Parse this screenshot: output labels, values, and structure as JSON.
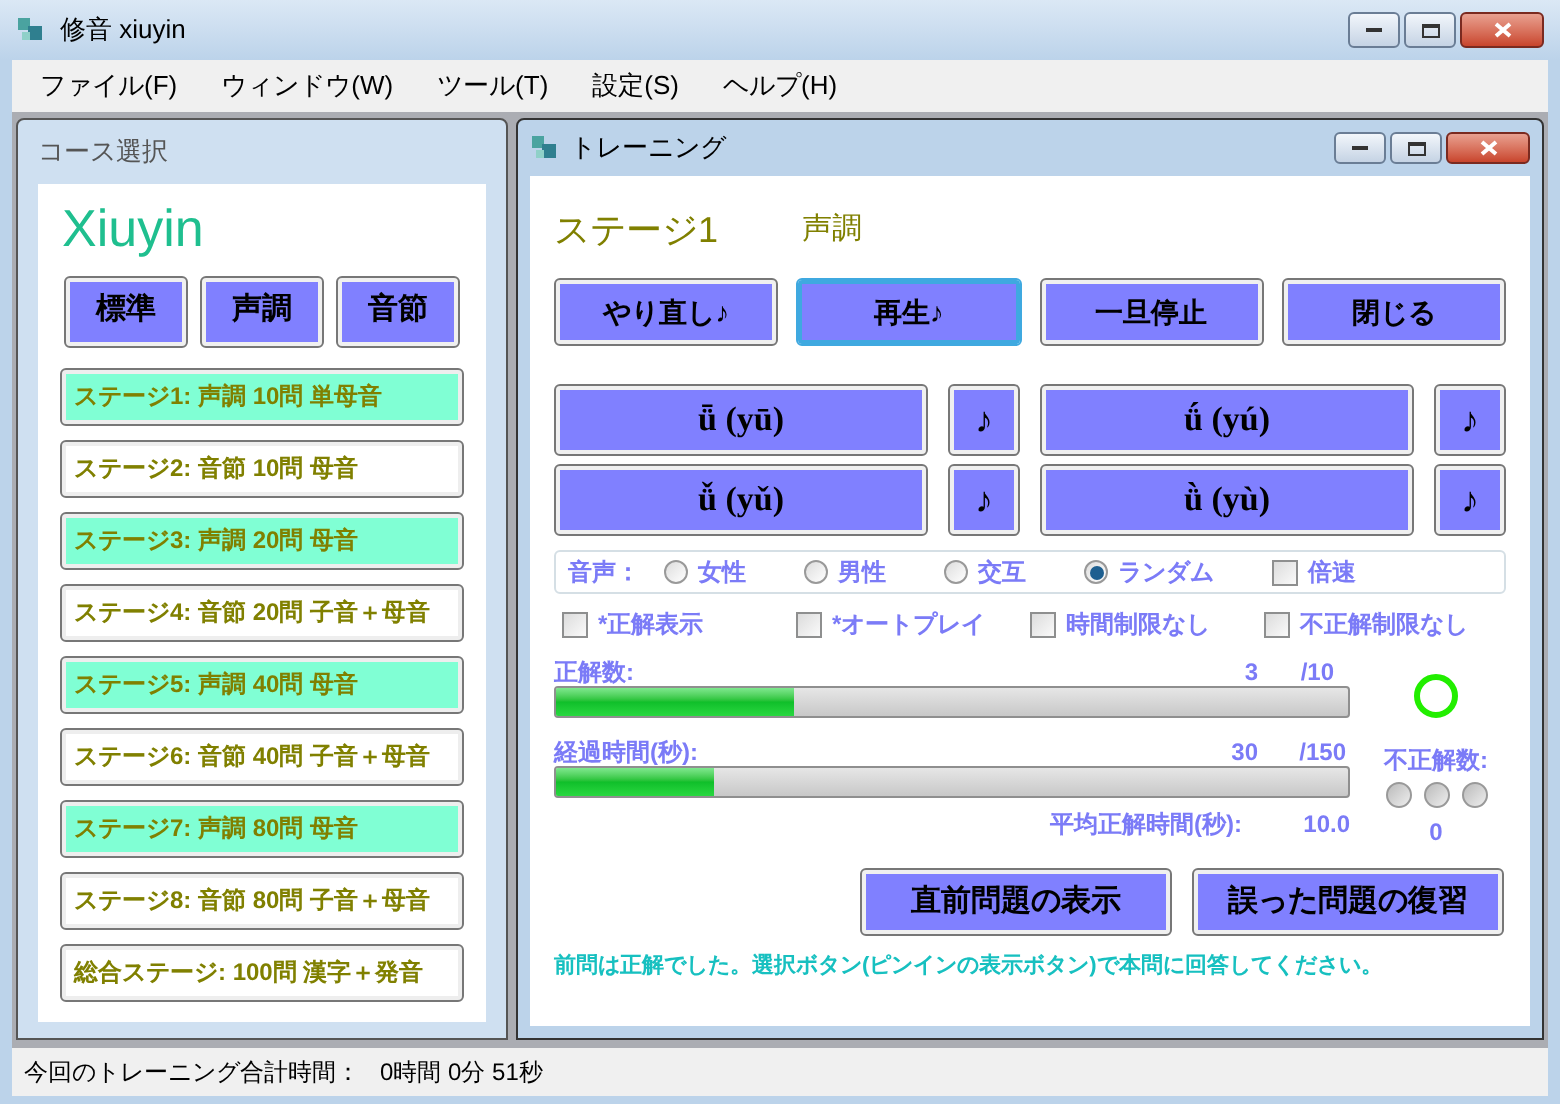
{
  "window": {
    "title": "修音 xiuyin"
  },
  "menu": [
    "ファイル(F)",
    "ウィンドウ(W)",
    "ツール(T)",
    "設定(S)",
    "ヘルプ(H)"
  ],
  "course_panel": {
    "title": "コース選択",
    "logo": "Xiuyin",
    "modes": [
      "標準",
      "声調",
      "音節"
    ],
    "stages": [
      {
        "label": "ステージ1: 声調 10問 単母音",
        "color": "#80ffd4"
      },
      {
        "label": "ステージ2: 音節 10問 母音",
        "color": "#ffffff"
      },
      {
        "label": "ステージ3: 声調 20問 母音",
        "color": "#80ffd4"
      },
      {
        "label": "ステージ4: 音節 20問 子音＋母音",
        "color": "#ffffff"
      },
      {
        "label": "ステージ5: 声調 40問 母音",
        "color": "#80ffd4"
      },
      {
        "label": "ステージ6: 音節 40問 子音＋母音",
        "color": "#ffffff"
      },
      {
        "label": "ステージ7: 声調 80問 母音",
        "color": "#80ffd4"
      },
      {
        "label": "ステージ8: 音節 80問 子音＋母音",
        "color": "#ffffff"
      },
      {
        "label": "総合ステージ:  100問 漢字＋発音",
        "color": "#ffffff"
      }
    ]
  },
  "training": {
    "title": "トレーニング",
    "stage": "ステージ1",
    "mode": "声調",
    "controls": [
      {
        "label": "やり直し♪",
        "focused": false
      },
      {
        "label": "再生♪",
        "focused": true
      },
      {
        "label": "一旦停止",
        "focused": false
      },
      {
        "label": "閉じる",
        "focused": false
      }
    ],
    "answers": [
      {
        "label": "ǖ (yū)",
        "play": "♪"
      },
      {
        "label": "ǘ (yú)",
        "play": "♪"
      },
      {
        "label": "ǚ (yǔ)",
        "play": "♪"
      },
      {
        "label": "ǜ (yù)",
        "play": "♪"
      }
    ],
    "voice_label": "音声：",
    "voices": [
      {
        "label": "女性",
        "selected": false
      },
      {
        "label": "男性",
        "selected": false
      },
      {
        "label": "交互",
        "selected": false
      },
      {
        "label": "ランダム",
        "selected": true
      }
    ],
    "double_speed": {
      "label": "倍速",
      "checked": false
    },
    "options": [
      {
        "label": "*正解表示",
        "checked": false
      },
      {
        "label": "*オートプレイ",
        "checked": false
      },
      {
        "label": "時間制限なし",
        "checked": false
      },
      {
        "label": "不正解制限なし",
        "checked": false
      }
    ],
    "correct": {
      "label": "正解数:",
      "value": "3",
      "total": "/10",
      "level": 0.3
    },
    "elapsed": {
      "label": "経過時間(秒):",
      "value": "30",
      "total": "/150",
      "level": 0.2
    },
    "result_ok": true,
    "wrong": {
      "label": "不正解数:",
      "lights": [
        {
          "on": false
        },
        {
          "on": false
        },
        {
          "on": false
        }
      ],
      "count": "0"
    },
    "average": {
      "label": "平均正解時間(秒):",
      "value": "10.0"
    },
    "actions": [
      "直前問題の表示",
      "誤った問題の復習"
    ],
    "message": "前問は正解でした。選択ボタン(ピンインの表示ボタン)で本問に回答してください。"
  },
  "status_bar": {
    "label": "今回のトレーニング合計時間：",
    "value": "0時間 0分 51秒"
  }
}
